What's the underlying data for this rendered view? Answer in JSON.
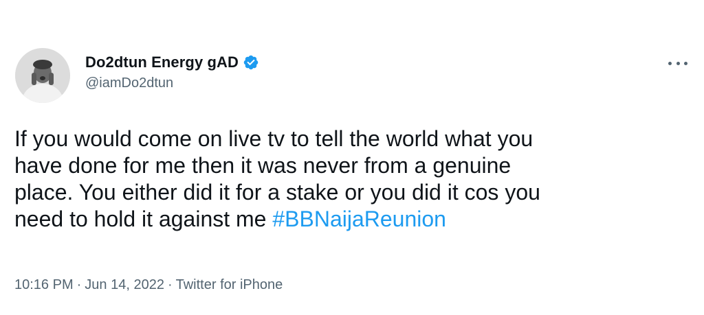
{
  "author": {
    "display_name": "Do2dtun Energy gAD",
    "handle": "@iamDo2dtun",
    "verified": true,
    "avatar_icon": "profile-photo"
  },
  "menu": {
    "icon": "more-horizontal-icon"
  },
  "tweet": {
    "text": "If you would come on live tv to tell the world what you\nhave done for me then it was never from a genuine\nplace. You either did it for a stake or you did it cos you\nneed to hold it against me ",
    "hashtag": "#BBNaijaReunion"
  },
  "meta": {
    "time": "10:16 PM",
    "separator": "·",
    "date": "Jun 14, 2022",
    "source": "Twitter for iPhone"
  },
  "colors": {
    "text": "#0f1419",
    "secondary": "#536471",
    "accent": "#1d9bf0"
  }
}
